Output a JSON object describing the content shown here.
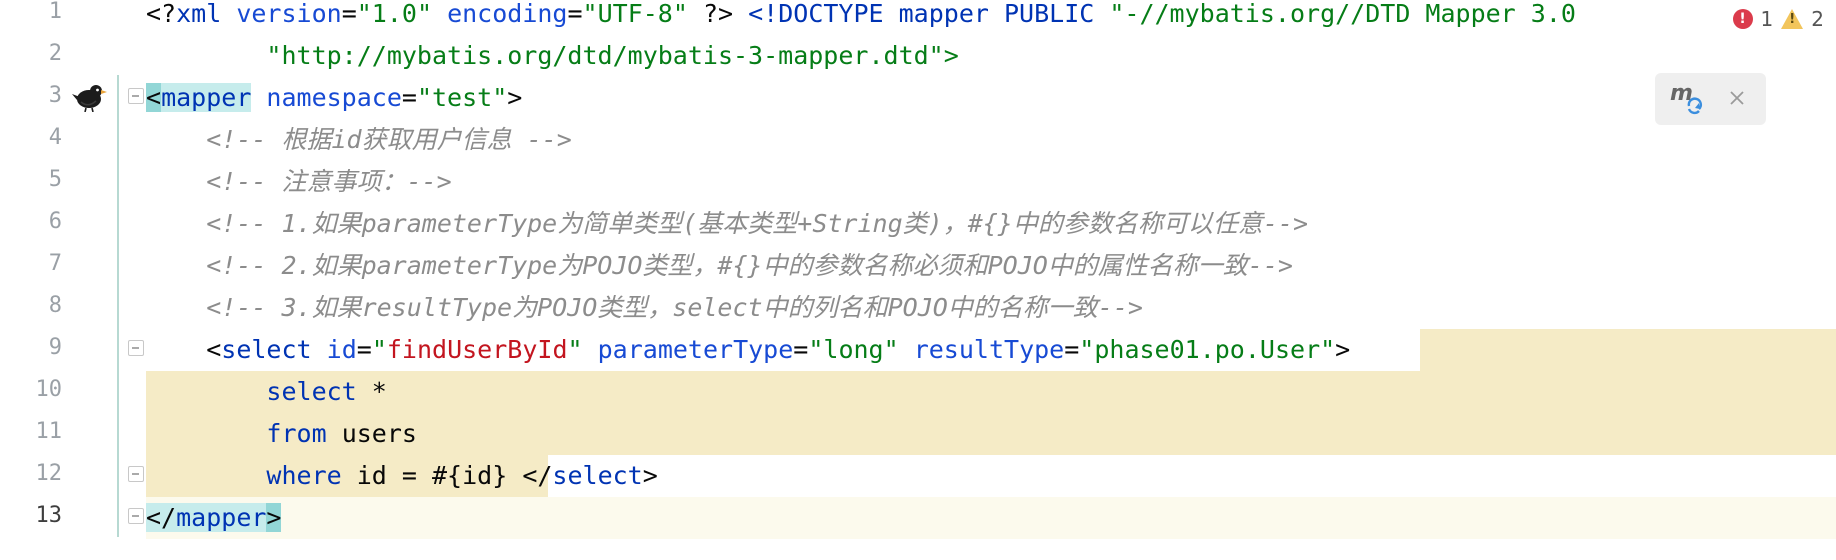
{
  "status": {
    "errors": "1",
    "warnings": "2"
  },
  "gutter": {
    "line_numbers": [
      "1",
      "2",
      "3",
      "4",
      "5",
      "6",
      "7",
      "8",
      "9",
      "10",
      "11",
      "12",
      "13"
    ]
  },
  "code": {
    "l1": {
      "a": "<?",
      "b": "xml",
      "c": " version",
      "d": "=",
      "e": "\"1.0\"",
      "f": " encoding",
      "g": "=",
      "h": "\"UTF-8\"",
      "i": " ?>",
      "j": " <!DOCTYPE mapper PUBLIC",
      "k": " \"-//mybatis.org//DTD Mapper 3.0"
    },
    "l2": {
      "a": "        \"http://mybatis.org/dtd/mybatis-3-mapper.dtd\">"
    },
    "l3": {
      "open": "<",
      "tag": "mapper",
      "attr": " namespace",
      "eq": "=",
      "val": "\"test\"",
      "close": ">"
    },
    "l4": "    <!-- 根据id获取用户信息 -->",
    "l5": "    <!-- 注意事项：-->",
    "l6": "    <!-- 1.如果parameterType为简单类型(基本类型+String类)，#{}中的参数名称可以任意-->",
    "l7": "    <!-- 2.如果parameterType为POJO类型，#{}中的参数名称必须和POJO中的属性名称一致-->",
    "l8": "    <!-- 3.如果resultType为POJO类型，select中的列名和POJO中的名称一致-->",
    "l9": {
      "indent": "    ",
      "open": "<",
      "tag": "select",
      "a1": " id",
      "eq1": "=",
      "q1": "\"",
      "v1": "findUserById",
      "q2": "\"",
      "a2": " parameterType",
      "eq2": "=",
      "v2": "\"long\"",
      "a3": " resultType",
      "eq3": "=",
      "v3": "\"phase01.po.User\"",
      "close": ">"
    },
    "l10": {
      "indent": "        ",
      "kw": "select",
      "rest": " *"
    },
    "l11": {
      "indent": "        ",
      "kw": "from",
      "rest": " users"
    },
    "l12": {
      "indent": "        ",
      "kw": "where",
      "rest": " id = #{id} ",
      "ctag_open": "</",
      "ctag": "select",
      "ctag_close": ">"
    },
    "l13": {
      "open": "</",
      "tag": "mapper",
      "close": ">"
    }
  },
  "colors": {
    "selection": "#f5ebc6",
    "current_line": "#fcfaed",
    "tag": "#0033b3",
    "string": "#067d17",
    "comment": "#8c8c8c"
  }
}
